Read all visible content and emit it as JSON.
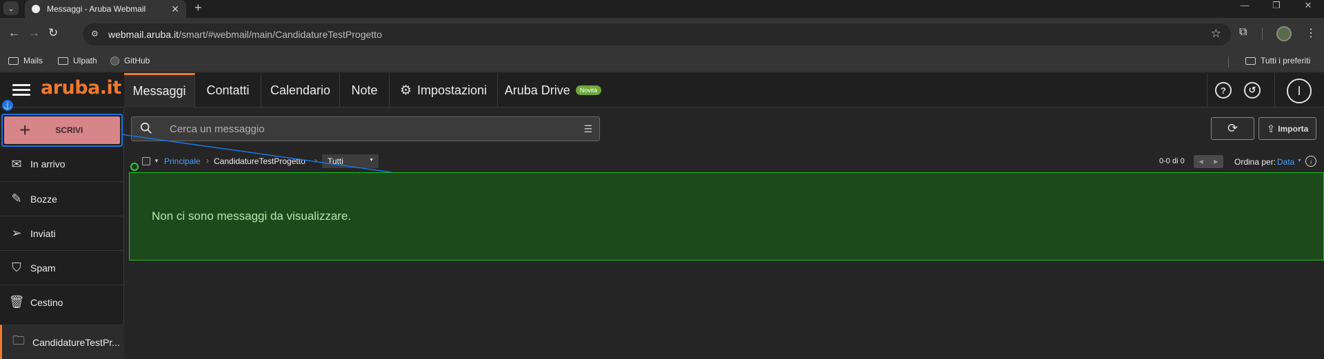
{
  "browser": {
    "tab_title": "Messaggi - Aruba Webmail",
    "url_host": "webmail.aruba.it",
    "url_path": "/smart/#webmail/main/CandidatureTestProgetto",
    "bookmarks": [
      "Mails",
      "Ulpath",
      "GitHub"
    ],
    "all_bookmarks": "Tutti i preferiti"
  },
  "app": {
    "logo": "aruba.it",
    "tabs": [
      {
        "label": "Messaggi"
      },
      {
        "label": "Contatti"
      },
      {
        "label": "Calendario"
      },
      {
        "label": "Note"
      },
      {
        "label": "Impostazioni"
      },
      {
        "label": "Aruba Drive",
        "badge": "Novità"
      }
    ],
    "user_initial": "I"
  },
  "sidebar": {
    "compose_label": "SCRIVI",
    "folders": [
      {
        "label": "In arrivo",
        "icon": "envelope-icon"
      },
      {
        "label": "Bozze",
        "icon": "draft-icon"
      },
      {
        "label": "Inviati",
        "icon": "send-icon"
      },
      {
        "label": "Spam",
        "icon": "spam-shield-icon"
      },
      {
        "label": "Cestino",
        "icon": "trash-icon"
      },
      {
        "label": "CandidatureTestPr...",
        "icon": "folder-icon"
      }
    ]
  },
  "search": {
    "placeholder": "Cerca un messaggio"
  },
  "toolbar": {
    "import_label": "Importa",
    "breadcrumb_root": "Principale",
    "breadcrumb_current": "CandidatureTestProgetto",
    "filter_value": "Tutti",
    "count": "0-0 di 0",
    "sort_label": "Ordina per:",
    "sort_value": "Data"
  },
  "messages": {
    "empty_text": "Non ci sono messaggi da visualizzare."
  },
  "colors": {
    "accent": "#f0782d",
    "link": "#4d9ff5",
    "highlight": "#1fc21f",
    "compose_bg": "#d8858a"
  }
}
